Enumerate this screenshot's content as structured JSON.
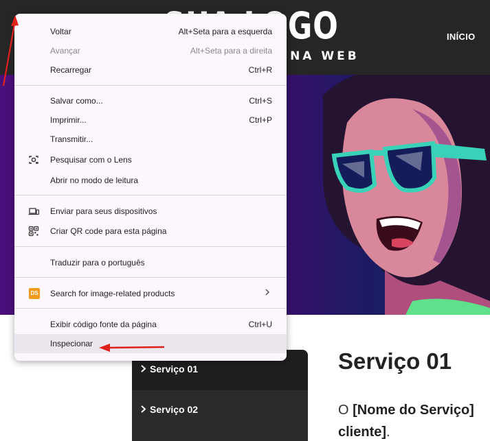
{
  "header": {
    "logo_text": "SUA LOGO",
    "logo_tagline": "A NA WEB",
    "nav_inicio": "INÍCIO"
  },
  "services": {
    "items": [
      {
        "label": "Serviço 01"
      },
      {
        "label": "Serviço 02"
      }
    ]
  },
  "content": {
    "title": "Serviço 01",
    "text_prefix": "O",
    "text_bold": "[Nome do Serviço]",
    "text_line2": "cliente]",
    "text_end": "."
  },
  "context_menu": {
    "items": [
      {
        "label": "Voltar",
        "shortcut": "Alt+Seta para a esquerda"
      },
      {
        "label": "Avançar",
        "shortcut": "Alt+Seta para a direita"
      },
      {
        "label": "Recarregar",
        "shortcut": "Ctrl+R"
      },
      {
        "label": "Salvar como...",
        "shortcut": "Ctrl+S"
      },
      {
        "label": "Imprimir...",
        "shortcut": "Ctrl+P"
      },
      {
        "label": "Transmitir...",
        "shortcut": ""
      },
      {
        "label": "Pesquisar com o Lens",
        "shortcut": ""
      },
      {
        "label": "Abrir no modo de leitura",
        "shortcut": ""
      },
      {
        "label": "Enviar para seus dispositivos",
        "shortcut": ""
      },
      {
        "label": "Criar QR code para esta página",
        "shortcut": ""
      },
      {
        "label": "Traduzir para o português",
        "shortcut": ""
      },
      {
        "label": "Search for image-related products",
        "shortcut": "",
        "badge": "DS"
      },
      {
        "label": "Exibir código fonte da página",
        "shortcut": "Ctrl+U"
      },
      {
        "label": "Inspecionar",
        "shortcut": ""
      }
    ]
  },
  "colors": {
    "header_bg": "#262626",
    "menu_bg": "#fcf7fd",
    "menu_hover": "#ece6ee",
    "annotation_red": "#e0201b",
    "ds_badge": "#f29a1b"
  },
  "icons": {
    "lens": "camera-search-icon",
    "send_devices": "devices-icon",
    "qr": "qr-code-icon",
    "submenu": "chevron-right-icon"
  }
}
